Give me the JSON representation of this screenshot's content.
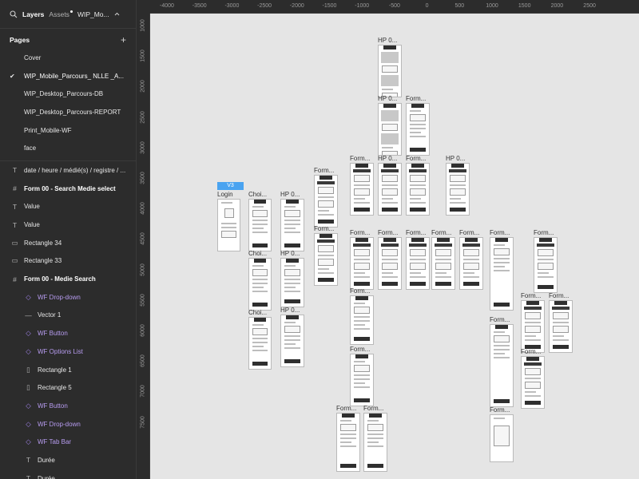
{
  "sidebar": {
    "tabs": {
      "layers": "Layers",
      "assets": "Assets",
      "file": "WIP_Mo..."
    },
    "pages_title": "Pages",
    "pages": [
      {
        "label": "Cover",
        "current": false
      },
      {
        "label": "WIP_Mobile_Parcours_ NLLE _A...",
        "current": true
      },
      {
        "label": "WIP_Desktop_Parcours-DB",
        "current": false
      },
      {
        "label": "WIP_Desktop_Parcours-REPORT",
        "current": false
      },
      {
        "label": "Print_Mobile-WF",
        "current": false
      },
      {
        "label": "face",
        "current": false
      }
    ],
    "layers": [
      {
        "icon": "text-icon",
        "label": "date / heure / médié(s) / registre / ..."
      },
      {
        "icon": "frame-icon",
        "label": "Form 00 - Search Medie select"
      },
      {
        "icon": "text-icon",
        "label": "Value"
      },
      {
        "icon": "text-icon",
        "label": "Value"
      },
      {
        "icon": "rectangle-icon",
        "label": "Rectangle 34"
      },
      {
        "icon": "rectangle-icon",
        "label": "Rectangle 33"
      },
      {
        "icon": "frame-icon",
        "label": "Form 00 - Medie Search"
      },
      {
        "icon": "component-instance-icon",
        "label": "WF Drop-down"
      },
      {
        "icon": "vector-icon",
        "label": "Vector 1"
      },
      {
        "icon": "component-instance-icon",
        "label": "WF Button"
      },
      {
        "icon": "component-instance-icon",
        "label": "WF Options List"
      },
      {
        "icon": "rectangle-vertical-icon",
        "label": "Rectangle 1"
      },
      {
        "icon": "rectangle-vertical-icon",
        "label": "Rectangle 5"
      },
      {
        "icon": "component-instance-icon",
        "label": "WF Button"
      },
      {
        "icon": "component-instance-icon",
        "label": "WF Drop-down"
      },
      {
        "icon": "component-instance-icon",
        "label": "WF Tab Bar"
      },
      {
        "icon": "text-icon",
        "label": "Durée"
      },
      {
        "icon": "text-icon",
        "label": "Durée"
      }
    ]
  },
  "canvas": {
    "ruler_x": [
      "-4000",
      "-3500",
      "-3000",
      "-2500",
      "-2000",
      "-1500",
      "-1000",
      "-500",
      "0",
      "500",
      "1000",
      "1500",
      "2000",
      "2500"
    ],
    "ruler_y": [
      "1000",
      "1500",
      "2000",
      "2500",
      "3000",
      "3500",
      "4000",
      "4500",
      "5000",
      "5500",
      "6000",
      "6500",
      "7000",
      "7500"
    ],
    "badge": "V3",
    "frame_labels": {
      "login": "Login",
      "choi": "Choi...",
      "hp": "HP 0...",
      "form": "Form..."
    }
  }
}
